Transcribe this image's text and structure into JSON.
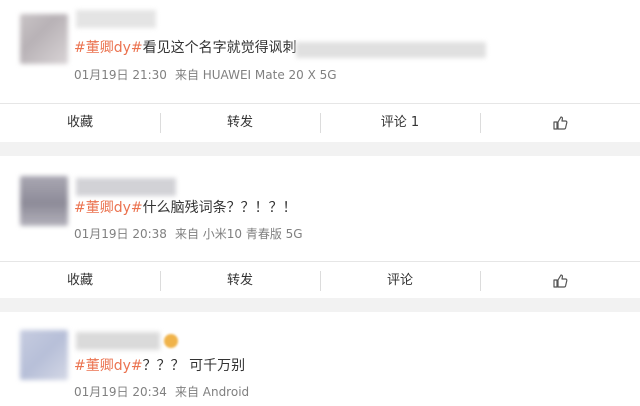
{
  "posts": [
    {
      "hashtag": "#董卿dy#",
      "text": "看见这个名字就觉得讽刺",
      "time": "01月19日 21:30",
      "source": "来自 HUAWEI Mate 20 X 5G",
      "actions": {
        "collect": "收藏",
        "repost": "转发",
        "comment": "评论 1"
      }
    },
    {
      "hashtag": "#董卿dy#",
      "text": "什么脑残词条？？！？！",
      "time": "01月19日 20:38",
      "source": "来自 小米10 青春版 5G",
      "actions": {
        "collect": "收藏",
        "repost": "转发",
        "comment": "评论"
      }
    },
    {
      "hashtag": "#董卿dy#",
      "text": "？？？ 可千万别",
      "time": "01月19日 20:34",
      "source": "来自 Android"
    }
  ],
  "icons": {
    "like": "thumbs-up-icon"
  },
  "colors": {
    "hashtag": "#eb7350",
    "meta": "#808080",
    "background": "#f2f2f2"
  }
}
